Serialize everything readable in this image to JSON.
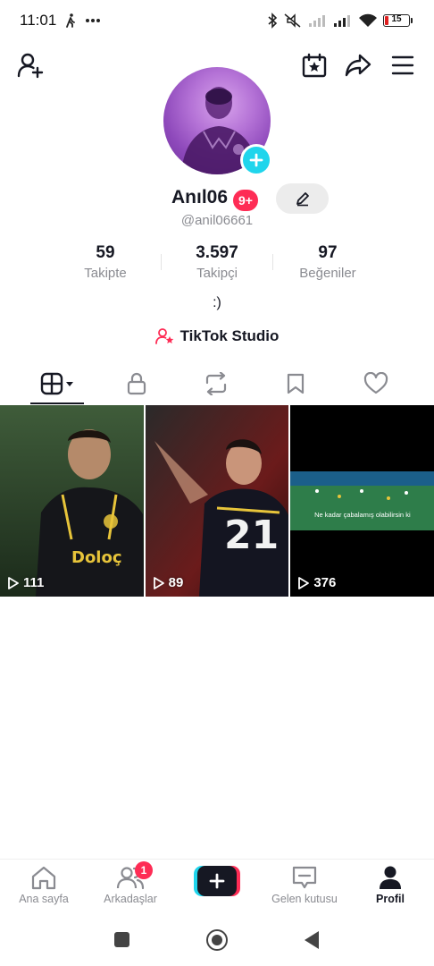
{
  "status_bar": {
    "time": "11:01",
    "icons": [
      "walking-icon",
      "more-dots-icon",
      "bluetooth-icon",
      "mute-icon",
      "signal-icon",
      "signal-icon",
      "wifi-icon",
      "battery-icon"
    ],
    "battery": "15",
    "battery_color": "#e02020"
  },
  "header": {
    "icons": [
      "add-friend-icon",
      "calendar-star-icon",
      "share-icon",
      "menu-icon"
    ]
  },
  "profile": {
    "username": "Anıl06",
    "badge": "9+",
    "handle": "@anil06661",
    "bio": ":)",
    "studio_label": "TikTok Studio"
  },
  "stats": [
    {
      "value": "59",
      "label": "Takipte"
    },
    {
      "value": "3.597",
      "label": "Takipçi"
    },
    {
      "value": "97",
      "label": "Beğeniler"
    }
  ],
  "tabs": [
    "videos-grid-icon",
    "lock-icon",
    "repost-icon",
    "bookmark-icon",
    "heart-icon"
  ],
  "videos": [
    {
      "views": "111",
      "overlay": ""
    },
    {
      "views": "89",
      "overlay": ""
    },
    {
      "views": "376",
      "overlay": "Ne kadar çabalamış olabilirsin ki"
    }
  ],
  "bottom_nav": {
    "home": "Ana sayfa",
    "friends": "Arkadaşlar",
    "friends_badge": "1",
    "inbox": "Gelen kutusu",
    "profile": "Profil"
  },
  "colors": {
    "accent_red": "#fe2c55",
    "accent_cyan": "#20d5ec",
    "text_primary": "#161823",
    "text_secondary": "#8a8b91"
  }
}
